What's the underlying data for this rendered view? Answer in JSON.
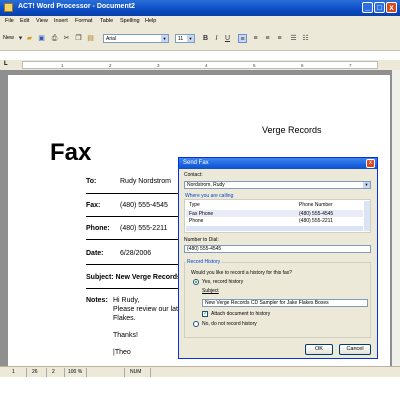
{
  "window": {
    "title": "ACT! Word Processor - Document2",
    "min": "_",
    "max": "□",
    "close": "x"
  },
  "menu": [
    "File",
    "Edit",
    "View",
    "Insert",
    "Format",
    "Table",
    "Spelling",
    "Help"
  ],
  "toolbar": {
    "new_label": "New",
    "font": "Arial",
    "size": "11",
    "bold": "B",
    "italic": "I",
    "underline": "U"
  },
  "ruler": {
    "tab_glyph": "L",
    "numbers": [
      "1",
      "2",
      "3",
      "4",
      "5",
      "6",
      "7"
    ]
  },
  "document": {
    "company": "Verge Records",
    "heading": "Fax",
    "rows": [
      {
        "label": "To:",
        "value": "Rudy Nordstrom"
      },
      {
        "label": "Fax:",
        "value": "(480) 555-4545"
      },
      {
        "label": "Phone:",
        "value": "(480) 555-2211"
      },
      {
        "label": "Date:",
        "value": "6/28/2006"
      }
    ],
    "subject": "Subject: New Verge Records",
    "notes_label": "Notes:",
    "notes_lines": [
      "Hi Rudy,",
      "Please review our late",
      "Flakes.",
      "",
      "Thanks!",
      "",
      "|Theo"
    ]
  },
  "dialog": {
    "title": "Send Fax",
    "close": "x",
    "contact_label": "Contact:",
    "contact_value": "Nordstrom, Rudy",
    "calling_label": "Where you are calling",
    "table_headers": [
      "Type",
      "Phone Number"
    ],
    "table_rows": [
      [
        "Fax Phone",
        "(480) 555-4545"
      ],
      [
        "Phone",
        "(480) 555-2211"
      ]
    ],
    "number_label": "Number to Dial:",
    "number_value": "(480) 555-4545",
    "history_group": "Record History",
    "history_question": "Would you like to record a history for this fax?",
    "yes_label": "Yes, record history",
    "subject_label": "Subject",
    "subject_value": "New Verge Records CD Sampler for Jake Flakes Boxes",
    "attach_label": "Attach document to history",
    "no_label": "No, do not record history",
    "ok": "OK",
    "cancel": "Cancel"
  },
  "status": {
    "page": "1",
    "line": "26",
    "col": "2",
    "zoom": "100 %",
    "num": "NUM"
  }
}
